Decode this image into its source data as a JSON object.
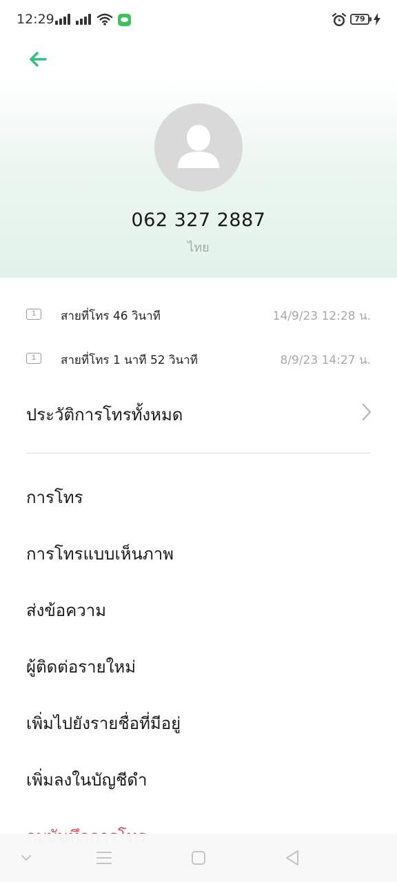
{
  "status_bar": {
    "time": "12:29",
    "battery": "79"
  },
  "contact": {
    "phone": "062 327 2887",
    "location": "ไทย"
  },
  "call_history": [
    {
      "text": "สายที่โทร  46 วินาที",
      "time": "14/9/23 12:28 น.",
      "sim": "1"
    },
    {
      "text": "สายที่โทร  1  นาที 52 วินาที",
      "time": "8/9/23 14:27 น.",
      "sim": "1"
    }
  ],
  "history_link": "ประวัติการโทรทั้งหมด",
  "menu": [
    {
      "label": "การโทร"
    },
    {
      "label": "การโทรแบบเห็นภาพ"
    },
    {
      "label": "ส่งข้อความ"
    },
    {
      "label": "ผู้ติดต่อรายใหม่"
    },
    {
      "label": "เพิ่มไปยังรายชื่อที่มีอยู่"
    },
    {
      "label": "เพิ่มลงในบัญชีดำ"
    },
    {
      "label": "ลบบันทึกการโทร"
    }
  ],
  "colors": {
    "accent": "#2fbf7f",
    "danger": "#e25060",
    "secondary_text": "#a8a8a8"
  }
}
